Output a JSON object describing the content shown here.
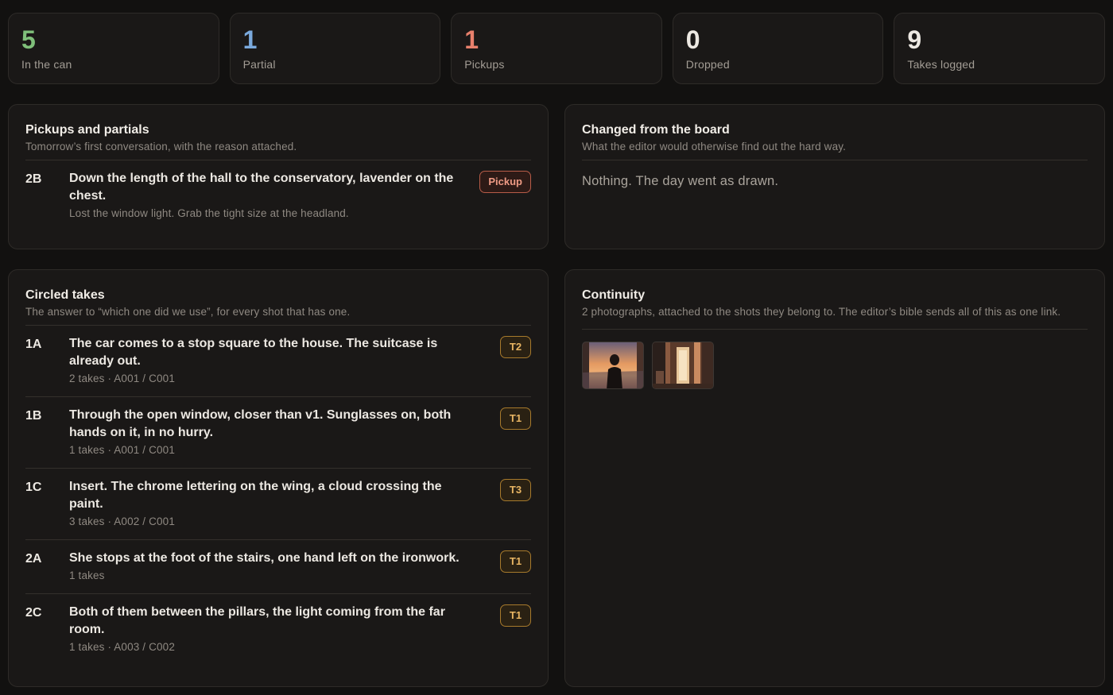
{
  "stats": [
    {
      "value": "5",
      "label": "In the can",
      "color": "#7fbf7a"
    },
    {
      "value": "1",
      "label": "Partial",
      "color": "#7aa9dc"
    },
    {
      "value": "1",
      "label": "Pickups",
      "color": "#e8806c"
    },
    {
      "value": "0",
      "label": "Dropped",
      "color": "#ece8e2"
    },
    {
      "value": "9",
      "label": "Takes logged",
      "color": "#ece8e2"
    }
  ],
  "pickups": {
    "title": "Pickups and partials",
    "subtitle": "Tomorrow’s first conversation, with the reason attached.",
    "rows": [
      {
        "id": "2B",
        "title": "Down the length of the hall to the conservatory, lavender on the chest.",
        "meta": "Lost the window light. Grab the tight size at the headland.",
        "badge": "Pickup"
      }
    ]
  },
  "changed": {
    "title": "Changed from the board",
    "subtitle": "What the editor would otherwise find out the hard way.",
    "empty": "Nothing. The day went as drawn."
  },
  "circled": {
    "title": "Circled takes",
    "subtitle": "The answer to “which one did we use”, for every shot that has one.",
    "rows": [
      {
        "id": "1A",
        "title": "The car comes to a stop square to the house. The suitcase is already out.",
        "meta": "2 takes · A001 / C001",
        "badge": "T2"
      },
      {
        "id": "1B",
        "title": "Through the open window, closer than v1. Sunglasses on, both hands on it, in no hurry.",
        "meta": "1 takes · A001 / C001",
        "badge": "T1"
      },
      {
        "id": "1C",
        "title": "Insert. The chrome lettering on the wing, a cloud crossing the paint.",
        "meta": "3 takes · A002 / C001",
        "badge": "T3"
      },
      {
        "id": "2A",
        "title": "She stops at the foot of the stairs, one hand left on the ironwork.",
        "meta": "1 takes",
        "badge": "T1"
      },
      {
        "id": "2C",
        "title": "Both of them between the pillars, the light coming from the far room.",
        "meta": "1 takes · A003 / C002",
        "badge": "T1"
      }
    ]
  },
  "continuity": {
    "title": "Continuity",
    "subtitle": "2 photographs, attached to the shots they belong to. The editor’s bible sends all of this as one link.",
    "photos": [
      "continuity-photo-woman-sunset",
      "continuity-photo-hallway"
    ]
  }
}
